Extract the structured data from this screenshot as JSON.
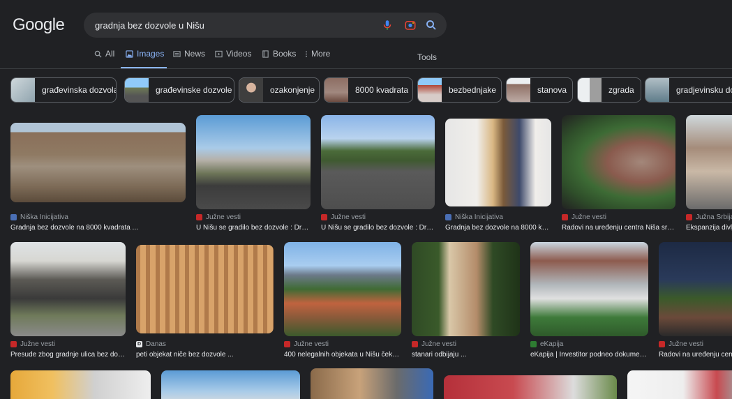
{
  "header": {
    "logo": "Google"
  },
  "search": {
    "query": "gradnja bez dozvole u Nišu"
  },
  "tabs": [
    {
      "label": "All",
      "icon": "search-icon"
    },
    {
      "label": "Images",
      "icon": "image-icon",
      "active": true
    },
    {
      "label": "News",
      "icon": "news-icon"
    },
    {
      "label": "Videos",
      "icon": "play-icon"
    },
    {
      "label": "Books",
      "icon": "book-icon"
    },
    {
      "label": "More",
      "icon": "more-vert-icon"
    }
  ],
  "tools_label": "Tools",
  "chips": [
    {
      "label": "građevinska dozvola"
    },
    {
      "label": "građevinske dozvole"
    },
    {
      "label": "ozakonjenje"
    },
    {
      "label": "8000 kvadrata"
    },
    {
      "label": "bezbednjake"
    },
    {
      "label": "stanova"
    },
    {
      "label": "zgrada"
    },
    {
      "label": "gradjevinsku dozvolu"
    }
  ],
  "results_row1": [
    {
      "source": "Niška Inicijativa",
      "title": "Gradnja bez dozvole na 8000 kvadrata ...",
      "fav_color": "#4a6fb5"
    },
    {
      "source": "Južne vesti",
      "title": "U Nišu se gradilo bez dozvole : Društ...",
      "fav_color": "#c62828"
    },
    {
      "source": "Južne vesti",
      "title": "U Nišu se gradilo bez dozvole : Društ...",
      "fav_color": "#c62828"
    },
    {
      "source": "Niška Inicijativa",
      "title": "Gradnja bez dozvole na 8000 kva...",
      "fav_color": "#4a6fb5"
    },
    {
      "source": "Južne vesti",
      "title": "Radovi na uređenju centra Niša sredi...",
      "fav_color": "#c62828"
    },
    {
      "source": "Južna Srbija ...",
      "title": "Ekspanzija divlje...",
      "fav_color": "#c62828"
    }
  ],
  "results_row2": [
    {
      "source": "Južne vesti",
      "title": "Presude zbog gradnje ulica bez dozv...",
      "fav_color": "#c62828"
    },
    {
      "source": "Danas",
      "title": "peti objekat niče bez dozvole ...",
      "fav_color": "#e8eaed",
      "fav_letter": "D"
    },
    {
      "source": "Južne vesti",
      "title": "400 nelegalnih objekata u Nišu čeka ...",
      "fav_color": "#c62828"
    },
    {
      "source": "Južne vesti",
      "title": "stanari odbijaju ...",
      "fav_color": "#c62828"
    },
    {
      "source": "eKapija",
      "title": "eKapija | Investitor podneo dokument...",
      "fav_color": "#2e7d32"
    },
    {
      "source": "Južne vesti",
      "title": "Radovi na uređenju centra ...",
      "fav_color": "#c62828"
    }
  ]
}
